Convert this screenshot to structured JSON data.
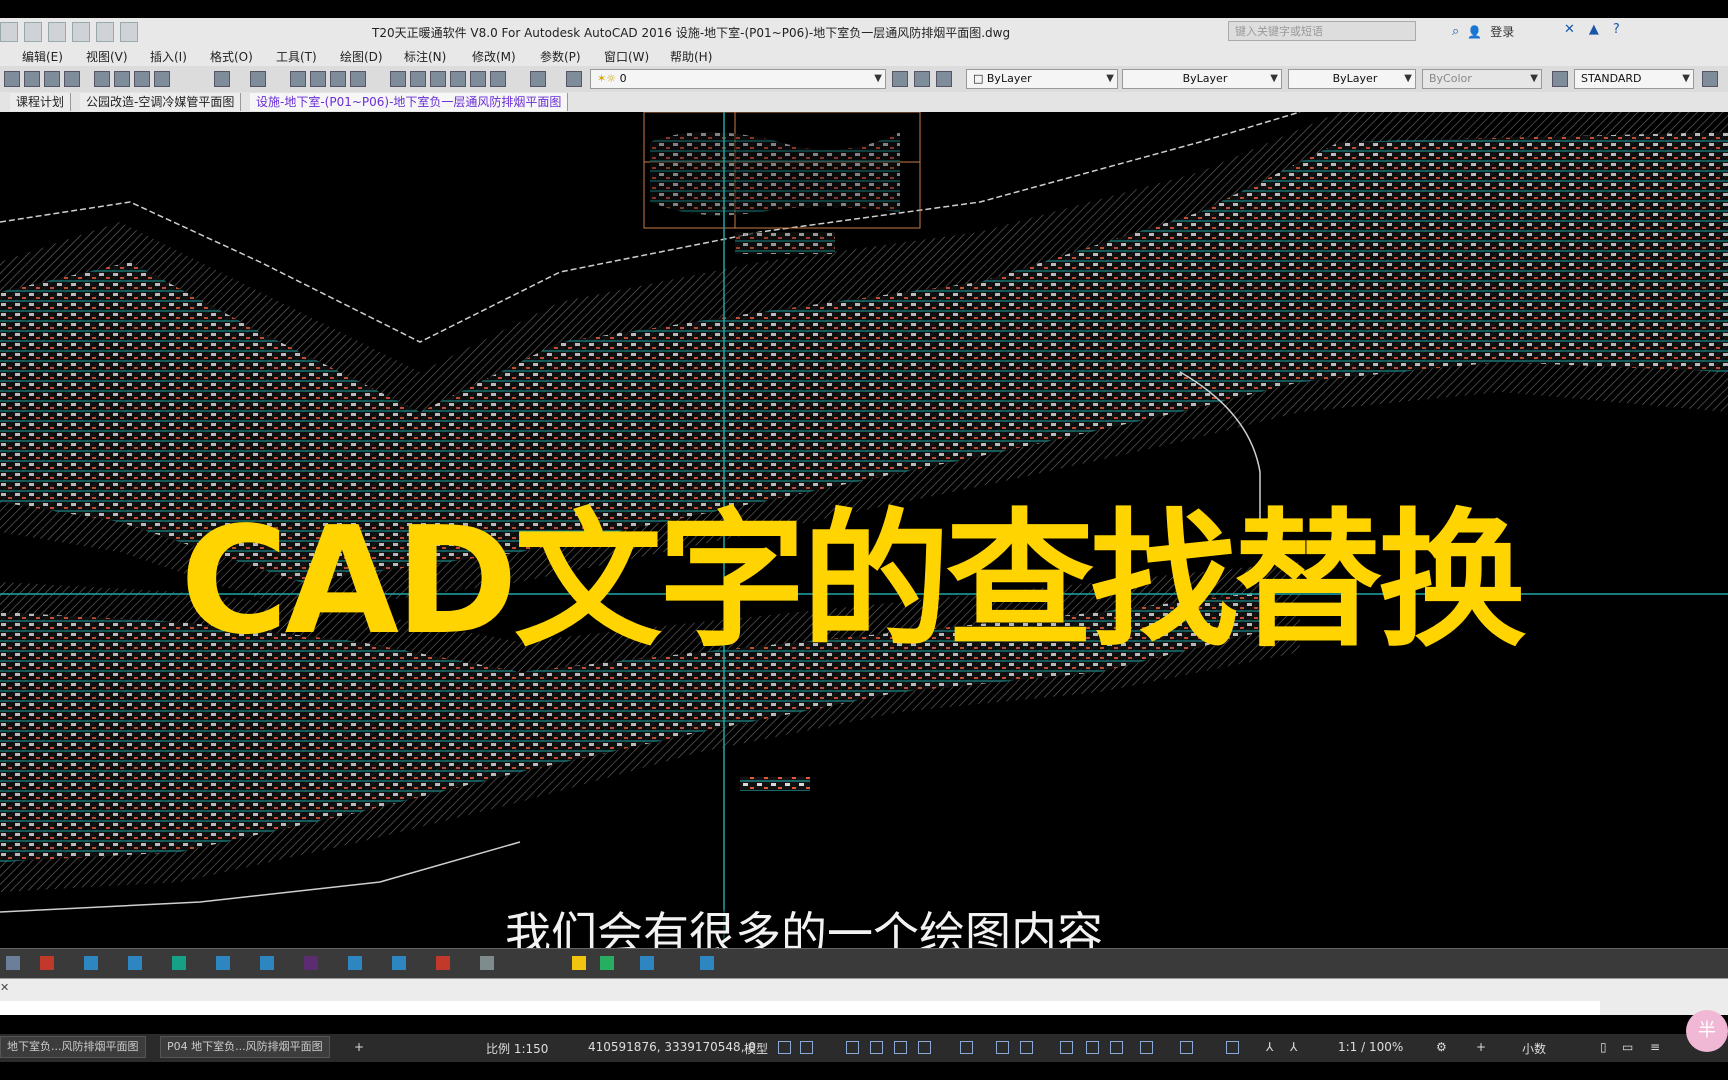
{
  "window": {
    "title": "T20天正暖通软件 V8.0 For Autodesk AutoCAD 2016    设施-地下室-(P01~P06)-地下室负一层通风防排烟平面图.dwg",
    "search_placeholder": "键入关键字或短语",
    "login_label": "登录"
  },
  "menu": [
    "编辑(E)",
    "视图(V)",
    "插入(I)",
    "格式(O)",
    "工具(T)",
    "绘图(D)",
    "标注(N)",
    "修改(M)",
    "参数(P)",
    "窗口(W)",
    "帮助(H)"
  ],
  "toolbar": {
    "layer_value": "0",
    "color_value": "ByLayer",
    "linetype_value": "ByLayer",
    "lineweight_value": "ByLayer",
    "plotstyle_value": "ByColor",
    "textstyle_value": "STANDARD"
  },
  "file_tabs": [
    {
      "label": "课程计划",
      "active": false
    },
    {
      "label": "公园改造-空调冷媒管平面图",
      "active": false
    },
    {
      "label": "设施-地下室-(P01~P06)-地下室负一层通风防排烟平面图",
      "active": true
    }
  ],
  "overlay": {
    "title": "CAD文字的查找替换",
    "subtitle": "我们会有很多的一个绘图内容"
  },
  "layout_tabs": [
    "地下室负...风防排烟平面图",
    "P04 地下室负...风防排烟平面图"
  ],
  "status": {
    "scale": "比例 1:150",
    "coordinates": "410591876, 3339170548, 0",
    "space": "模型",
    "annotation_scale": "1:1 / 100%",
    "units": "小数"
  },
  "colors": {
    "overlay_title": "#ffd400",
    "active_tab": "#6a2fd6",
    "drawing_bg": "#000000"
  }
}
